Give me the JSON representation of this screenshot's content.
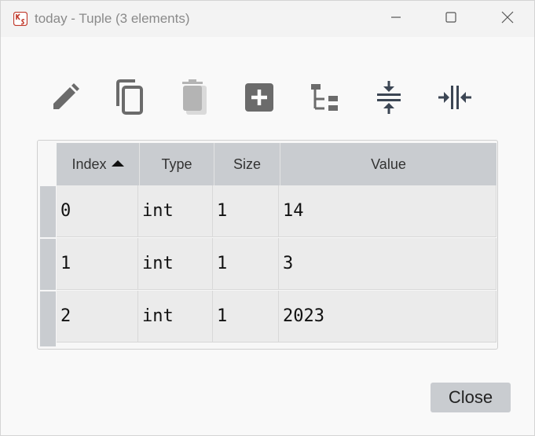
{
  "window": {
    "title": "today - Tuple (3 elements)",
    "app_icon": "kivy-tuple-icon",
    "controls": [
      "minimize-icon",
      "maximize-icon",
      "close-icon"
    ]
  },
  "toolbar": {
    "buttons": [
      {
        "name": "edit-button",
        "icon": "pencil-icon"
      },
      {
        "name": "copy-button",
        "icon": "copy-icon"
      },
      {
        "name": "delete-button",
        "icon": "trash-icon"
      },
      {
        "name": "insert-button",
        "icon": "plus-box-icon"
      },
      {
        "name": "tree-view-button",
        "icon": "tree-icon"
      },
      {
        "name": "collapse-rows-button",
        "icon": "compress-vertical-icon"
      },
      {
        "name": "collapse-columns-button",
        "icon": "compress-horizontal-icon"
      }
    ]
  },
  "table": {
    "headers": [
      "Index",
      "Type",
      "Size",
      "Value"
    ],
    "sorted_column": "Index",
    "sort_direction": "ascending",
    "rows": [
      [
        "0",
        "int",
        "1",
        "14"
      ],
      [
        "1",
        "int",
        "1",
        "3"
      ],
      [
        "2",
        "int",
        "1",
        "2023"
      ]
    ]
  },
  "footer": {
    "close_label": "Close"
  },
  "colors": {
    "header_bg": "#c9ccd0",
    "cell_bg": "#ebebeb",
    "icon_gray": "#6b6b6b",
    "icon_dark": "#3c4654"
  }
}
